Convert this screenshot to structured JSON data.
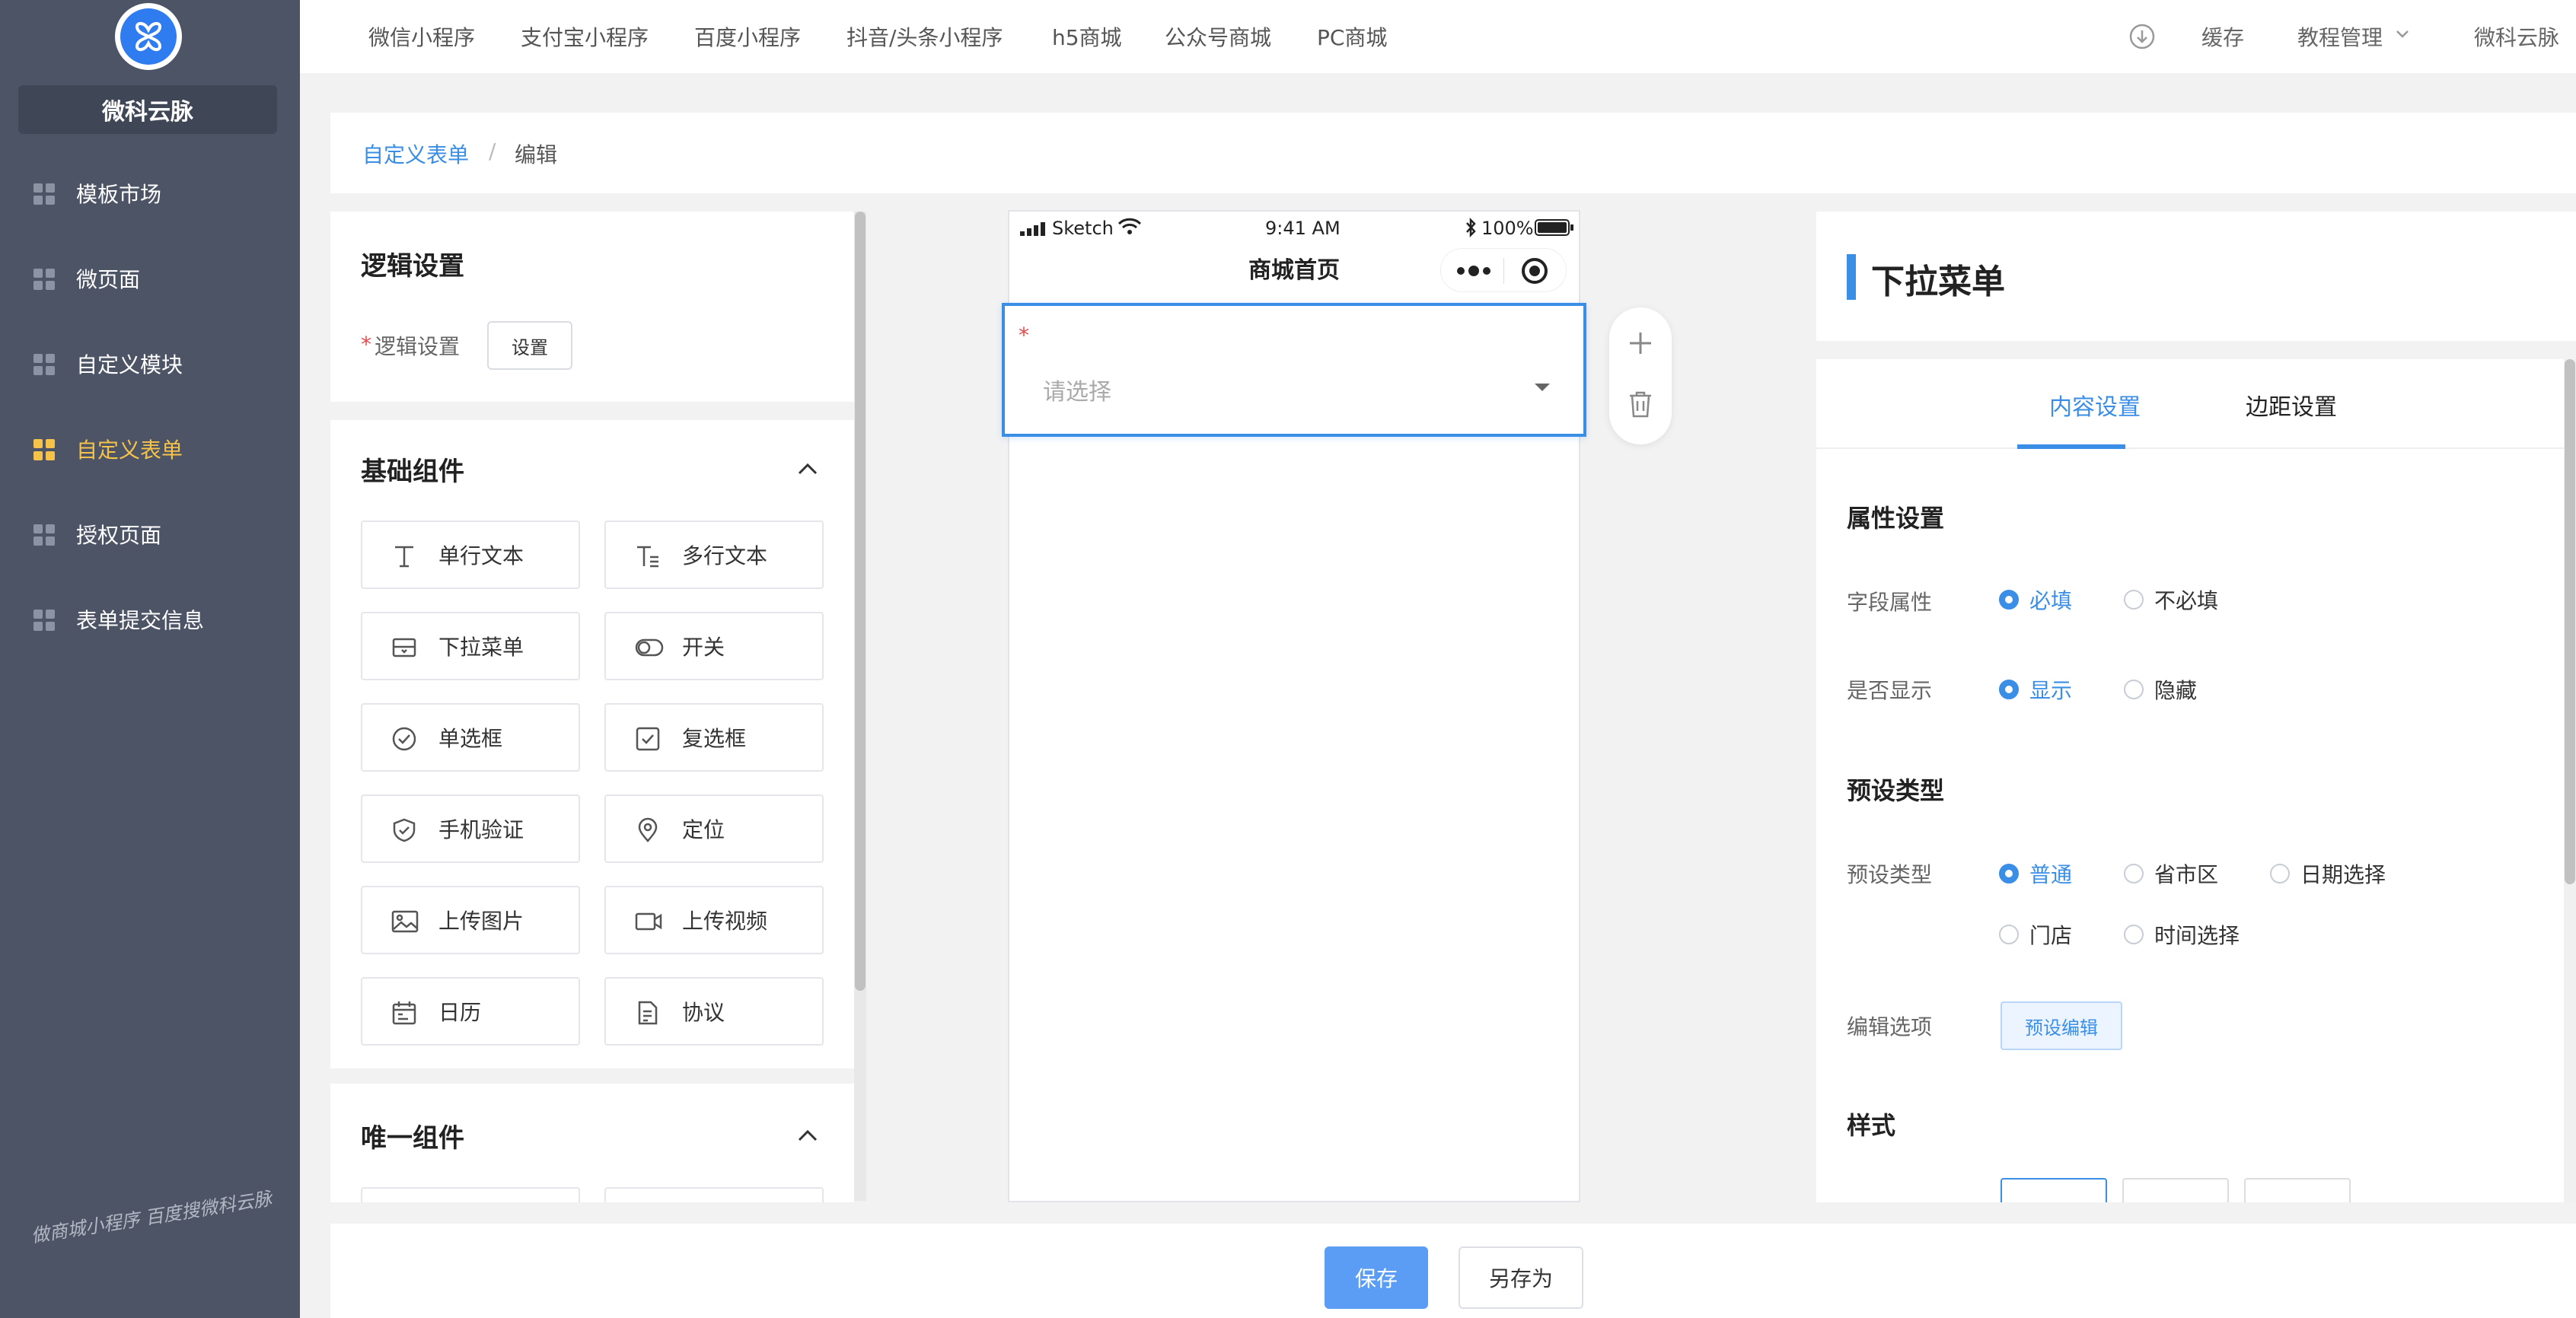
{
  "brand": {
    "name": "微科云脉"
  },
  "sidebar": {
    "items": [
      {
        "label": "模板市场"
      },
      {
        "label": "微页面"
      },
      {
        "label": "自定义模块"
      },
      {
        "label": "自定义表单"
      },
      {
        "label": "授权页面"
      },
      {
        "label": "表单提交信息"
      }
    ]
  },
  "watermark": "做商城小程序 百度搜微科云脉",
  "topnav": {
    "items": [
      "微信小程序",
      "支付宝小程序",
      "百度小程序",
      "抖音/头条小程序",
      "h5商城",
      "公众号商城",
      "PC商城"
    ],
    "cache": "缓存",
    "tutorial": "教程管理",
    "user": "微科云脉"
  },
  "breadcrumb": {
    "parent": "自定义表单",
    "sep": "/",
    "current": "编辑"
  },
  "logic": {
    "title": "逻辑设置",
    "required_mark": "*",
    "label": "逻辑设置",
    "button": "设置"
  },
  "basic": {
    "title": "基础组件",
    "items": [
      {
        "label": "单行文本",
        "icon": "text-icon"
      },
      {
        "label": "多行文本",
        "icon": "multiline-text-icon"
      },
      {
        "label": "下拉菜单",
        "icon": "dropdown-icon"
      },
      {
        "label": "开关",
        "icon": "switch-icon"
      },
      {
        "label": "单选框",
        "icon": "radio-icon"
      },
      {
        "label": "复选框",
        "icon": "checkbox-icon"
      },
      {
        "label": "手机验证",
        "icon": "shield-icon"
      },
      {
        "label": "定位",
        "icon": "location-icon"
      },
      {
        "label": "上传图片",
        "icon": "image-icon"
      },
      {
        "label": "上传视频",
        "icon": "video-icon"
      },
      {
        "label": "日历",
        "icon": "calendar-icon"
      },
      {
        "label": "协议",
        "icon": "document-icon"
      }
    ]
  },
  "unique": {
    "title": "唯一组件"
  },
  "phone": {
    "carrier": "Sketch",
    "time": "9:41 AM",
    "battery": "100%",
    "page_title": "商城首页",
    "field": {
      "required_mark": "*",
      "placeholder": "请选择"
    }
  },
  "props": {
    "title": "下拉菜单",
    "tabs": [
      {
        "label": "内容设置"
      },
      {
        "label": "边距设置"
      }
    ],
    "attr_section": "属性设置",
    "field_attr": {
      "label": "字段属性",
      "options": [
        "必填",
        "不必填"
      ],
      "selected": "必填"
    },
    "show": {
      "label": "是否显示",
      "options": [
        "显示",
        "隐藏"
      ],
      "selected": "显示"
    },
    "preset_section": "预设类型",
    "preset": {
      "label": "预设类型",
      "options": [
        "普通",
        "省市区",
        "日期选择",
        "门店",
        "时间选择"
      ],
      "selected": "普通"
    },
    "edit_opts": {
      "label": "编辑选项",
      "button": "预设编辑"
    },
    "style_section": "样式"
  },
  "footer": {
    "save": "保存",
    "save_as": "另存为"
  },
  "colors": {
    "sidebar": "#4d5466",
    "accent": "#3a8ee6",
    "active_nav": "#f5c34a",
    "primary_btn": "#5b9df5"
  }
}
